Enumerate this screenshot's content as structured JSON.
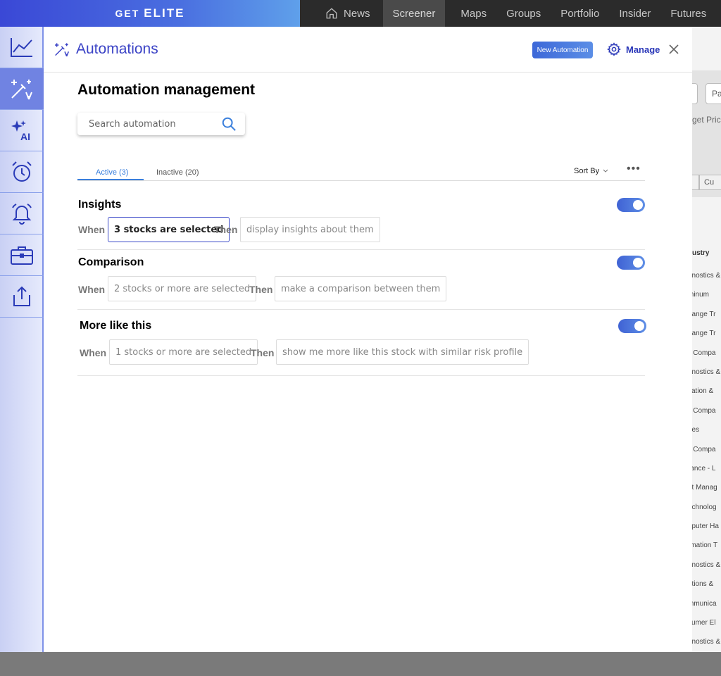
{
  "topbar": {
    "elite_get": "GET",
    "elite_brand": "ELITE",
    "nav": [
      {
        "label": "News",
        "icon": "home-icon"
      },
      {
        "label": "Screener",
        "active": true
      },
      {
        "label": "Maps"
      },
      {
        "label": "Groups"
      },
      {
        "label": "Portfolio"
      },
      {
        "label": "Insider"
      },
      {
        "label": "Futures"
      }
    ]
  },
  "sidebar": {
    "items": [
      {
        "icon": "chart-line-icon"
      },
      {
        "icon": "magic-wand-icon",
        "active": true
      },
      {
        "icon": "ai-sparkle-icon",
        "label": "AI"
      },
      {
        "icon": "alarm-clock-icon"
      },
      {
        "icon": "bell-icon"
      },
      {
        "icon": "briefcase-icon"
      },
      {
        "icon": "share-upload-icon"
      }
    ]
  },
  "modal": {
    "title": "Automations",
    "new_button": "New Automation",
    "manage_label": "Manage",
    "heading": "Automation management",
    "search_placeholder": "Search automation",
    "tabs": [
      {
        "label": "Active (3)",
        "active": true
      },
      {
        "label": "Inactive (20)"
      }
    ],
    "sort_by": "Sort By",
    "more": "•••",
    "rules": [
      {
        "title": "Insights",
        "when_label": "When",
        "when_value": "3 stocks are selected",
        "then_label": "Then",
        "then_value": "display insights about them",
        "enabled": true
      },
      {
        "title": "Comparison",
        "when_label": "When",
        "when_value": "2 stocks or more are selected",
        "then_label": "Then",
        "then_value": "make a comparison between them",
        "enabled": true
      },
      {
        "title": "More like this",
        "when_label": "When",
        "when_value": "1 stocks or more are selected",
        "then_label": "Then",
        "then_value": "show me more like this stock with similar risk profile",
        "enabled": true
      }
    ]
  },
  "background_page": {
    "button_text": "Pa",
    "target_text": "get Pric",
    "cell_text": "Cu",
    "industry_header": "ustry",
    "industry_rows": [
      "gnostics &",
      "minum",
      "hange Tr",
      "hange Tr",
      "ll Compa",
      "gnostics &",
      "cation &",
      "ll Compa",
      "nes",
      "ll Compa",
      "rance - L",
      "et Manag",
      "echnolog",
      "nputer Ha",
      "rmation T",
      "gnostics &",
      "utions &",
      "mmunica",
      "sumer El",
      "gnostics &"
    ]
  },
  "colors": {
    "accent": "#3b43c6",
    "tab_active": "#3a7fdc",
    "toggle": "#4f7ddc"
  }
}
